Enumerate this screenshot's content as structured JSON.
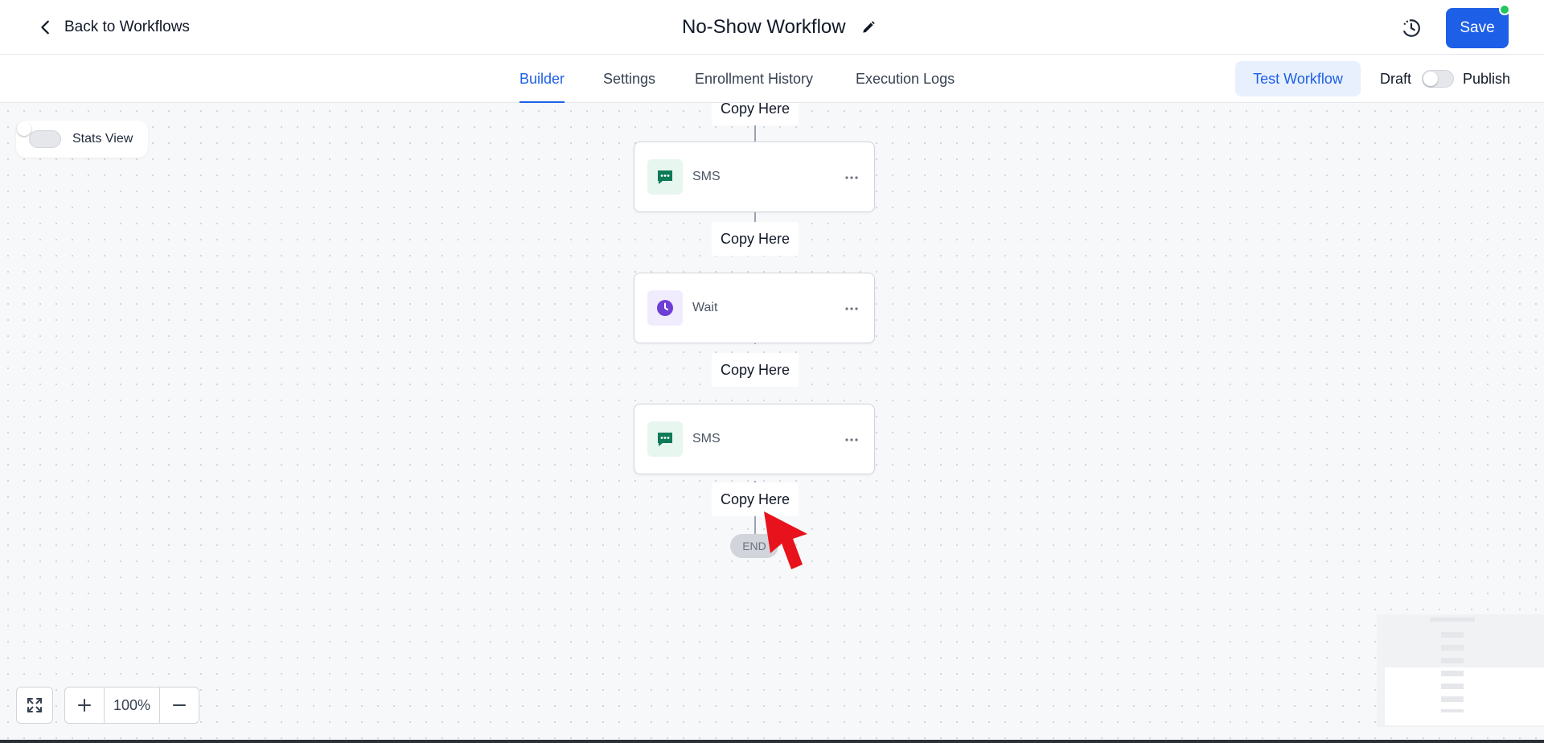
{
  "header": {
    "back_label": "Back to Workflows",
    "title": "No-Show Workflow",
    "save_label": "Save"
  },
  "nav": {
    "tabs": [
      {
        "label": "Builder",
        "active": true
      },
      {
        "label": "Settings",
        "active": false
      },
      {
        "label": "Enrollment History",
        "active": false
      },
      {
        "label": "Execution Logs",
        "active": false
      }
    ],
    "test_label": "Test Workflow",
    "draft_label": "Draft",
    "publish_label": "Publish"
  },
  "canvas": {
    "stats_label": "Stats View",
    "copy_label": "Copy Here",
    "nodes": [
      {
        "label": "SMS",
        "icon": "sms-icon"
      },
      {
        "label": "Wait",
        "icon": "clock-icon"
      },
      {
        "label": "SMS",
        "icon": "sms-icon"
      }
    ],
    "end_label": "END",
    "zoom_level": "100%"
  },
  "colors": {
    "primary": "#1d5fe6",
    "sms": "#0f7a57",
    "wait": "#6d3fd6",
    "online": "#22c55e",
    "pointer": "#e8121c"
  }
}
